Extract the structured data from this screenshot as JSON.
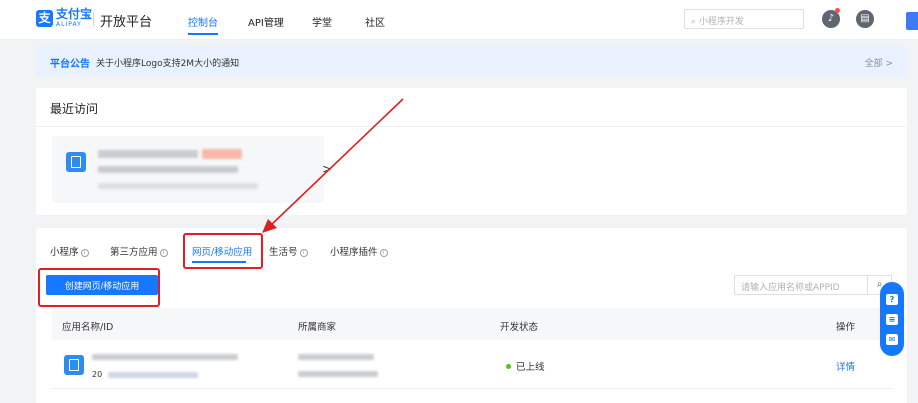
{
  "colors": {
    "accent": "#1677ff",
    "annotation": "#e02020",
    "status_online": "#52c41a"
  },
  "header": {
    "logo_cn": "支付宝",
    "logo_en": "ALIPAY",
    "platform": "开放平台",
    "nav": [
      "控制台",
      "API管理",
      "学堂",
      "社区"
    ],
    "active_nav": "控制台",
    "search_placeholder": "小程序开发",
    "icons": [
      "search-icon",
      "bell-icon",
      "message-icon"
    ]
  },
  "notice": {
    "title": "平台公告",
    "text": "关于小程序Logo支持2M大小的通知",
    "all_label": "全部 >"
  },
  "recent": {
    "title": "最近访问",
    "chevron": ">"
  },
  "tabs": [
    {
      "label": "小程序",
      "info": "i"
    },
    {
      "label": "第三方应用",
      "info": "i"
    },
    {
      "label": "网页/移动应用",
      "info": ""
    },
    {
      "label": "生活号",
      "info": "i"
    },
    {
      "label": "小程序插件",
      "info": "i"
    }
  ],
  "active_tab": "网页/移动应用",
  "actions": {
    "create_label": "创建网页/移动应用",
    "search_placeholder": "请输入应用名称或APPID"
  },
  "table": {
    "columns": [
      "应用名称/ID",
      "所属商家",
      "开发状态",
      "操作"
    ],
    "rows": [
      {
        "id_prefix": "20",
        "status": "已上线",
        "action": "详情"
      }
    ]
  },
  "float_icons": [
    "help-icon",
    "chat-icon",
    "feedback-icon"
  ]
}
